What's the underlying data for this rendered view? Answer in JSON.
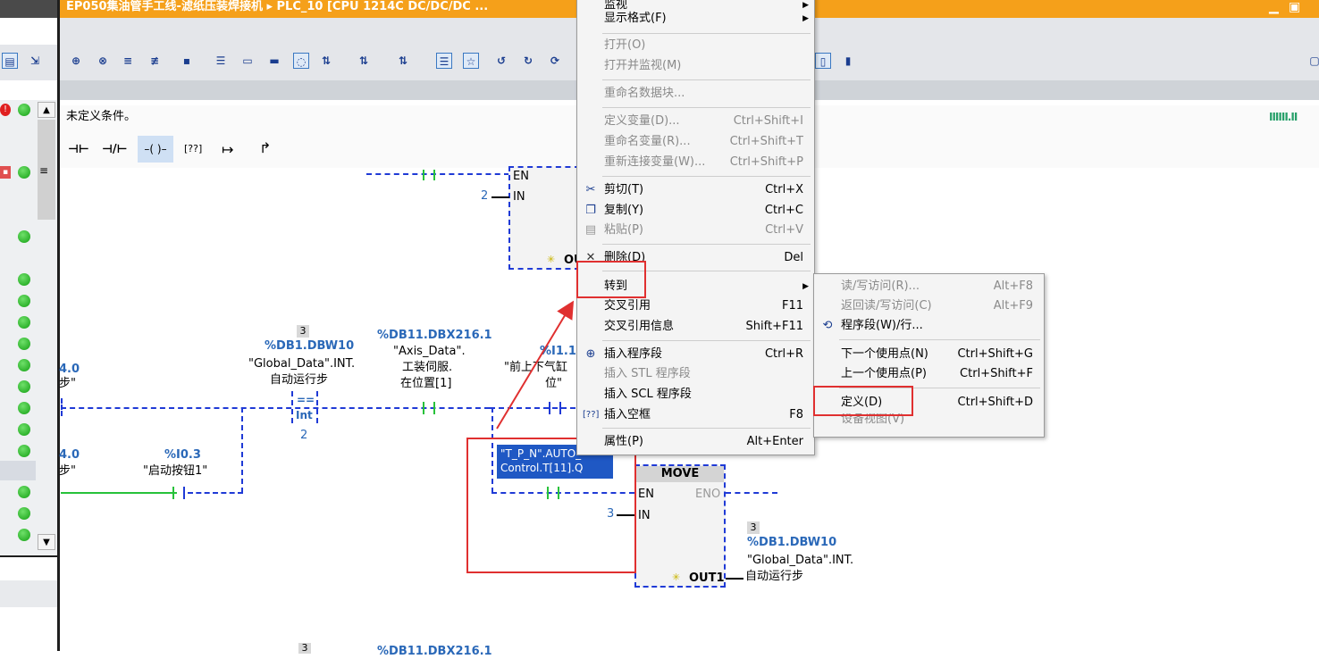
{
  "window": {
    "title": "EP050集油管手工线-滤纸压装焊接机 ▸ PLC_10 [CPU 1214C DC/DC/DC ..."
  },
  "editor": {
    "condition_text": "未定义条件。",
    "ladder_tools": [
      "⊣⊢",
      "⊣/⊢",
      "–( )–",
      "[??]",
      "↦",
      "↱"
    ]
  },
  "network": {
    "in_const_top": "2",
    "block_labels": {
      "en": "EN",
      "in": "IN",
      "out": "OUT1",
      "eno": "ENO"
    },
    "rung1_left_addr": "4.0",
    "rung1_left_tag": "步\"",
    "cmp_const": "3",
    "cmp_addr": "%DB1.DBW10",
    "cmp_tag1": "\"Global_Data\".INT.",
    "cmp_tag2": "自动运行步",
    "cmp_op1": "==",
    "cmp_op2": "Int",
    "cmp_below": "2",
    "axis_addr": "%DB11.DBX216.1",
    "axis_tag1": "\"Axis_Data\".",
    "axis_tag2": "工装伺服.",
    "axis_tag3": "在位置[1]",
    "cyl_addr": "%I1.1",
    "cyl_tag1": "\"前上下气缸",
    "cyl_tag2": "位\"",
    "rung2_left_addr": "4.0",
    "rung2_left_tag": "步\"",
    "start_addr": "%I0.3",
    "start_tag": "\"启动按钮1\"",
    "tpn_line1": "\"T_P_N\".AUTO_",
    "tpn_line2": "Control.T[11].Q",
    "move_title": "MOVE",
    "move_in": "3",
    "move_out_const": "3",
    "move_out_addr": "%DB1.DBW10",
    "move_out_tag1": "\"Global_Data\".INT.",
    "move_out_tag2": "自动运行步",
    "bottom_const": "3",
    "bottom_addr": "%DB11.DBX216.1"
  },
  "context_menu": {
    "items": [
      {
        "label": "监视",
        "shortcut": "",
        "disabled": false,
        "submenu": true
      },
      {
        "label": "显示格式(F)",
        "shortcut": "",
        "disabled": false,
        "submenu": true
      },
      {
        "label": "打开(O)",
        "shortcut": "",
        "disabled": true
      },
      {
        "label": "打开并监视(M)",
        "shortcut": "",
        "disabled": true
      },
      {
        "label": "重命名数据块...",
        "shortcut": "",
        "disabled": true
      },
      {
        "label": "定义变量(D)...",
        "shortcut": "Ctrl+Shift+I",
        "disabled": true
      },
      {
        "label": "重命名变量(R)...",
        "shortcut": "Ctrl+Shift+T",
        "disabled": true
      },
      {
        "label": "重新连接变量(W)...",
        "shortcut": "Ctrl+Shift+P",
        "disabled": true
      },
      {
        "label": "剪切(T)",
        "shortcut": "Ctrl+X",
        "disabled": false,
        "icon": "scissors-icon"
      },
      {
        "label": "复制(Y)",
        "shortcut": "Ctrl+C",
        "disabled": false,
        "icon": "copy-icon"
      },
      {
        "label": "粘贴(P)",
        "shortcut": "Ctrl+V",
        "disabled": true,
        "icon": "paste-icon"
      },
      {
        "label": "删除(D)",
        "shortcut": "Del",
        "disabled": false,
        "icon": "delete-icon"
      },
      {
        "label": "转到",
        "shortcut": "",
        "disabled": false,
        "submenu": true
      },
      {
        "label": "交叉引用",
        "shortcut": "F11",
        "disabled": false
      },
      {
        "label": "交叉引用信息",
        "shortcut": "Shift+F11",
        "disabled": false
      },
      {
        "label": "插入程序段",
        "shortcut": "Ctrl+R",
        "disabled": false,
        "icon": "insert-network-icon"
      },
      {
        "label": "插入 STL 程序段",
        "shortcut": "",
        "disabled": true
      },
      {
        "label": "插入 SCL 程序段",
        "shortcut": "",
        "disabled": false
      },
      {
        "label": "插入空框",
        "shortcut": "F8",
        "disabled": false,
        "icon": "empty-box-icon"
      },
      {
        "label": "属性(P)",
        "shortcut": "Alt+Enter",
        "disabled": false
      }
    ]
  },
  "submenu": {
    "items": [
      {
        "label": "读/写访问(R)...",
        "shortcut": "Alt+F8",
        "disabled": true
      },
      {
        "label": "返回读/写访问(C)",
        "shortcut": "Alt+F9",
        "disabled": true
      },
      {
        "label": "程序段(W)/行...",
        "shortcut": "",
        "disabled": false,
        "icon": "goto-network-icon"
      },
      {
        "label": "下一个使用点(N)",
        "shortcut": "Ctrl+Shift+G",
        "disabled": false
      },
      {
        "label": "上一个使用点(P)",
        "shortcut": "Ctrl+Shift+F",
        "disabled": false
      },
      {
        "label": "定义(D)",
        "shortcut": "Ctrl+Shift+D",
        "disabled": false
      },
      {
        "label": "设备视图(V)",
        "shortcut": "",
        "disabled": true
      }
    ]
  },
  "colors": {
    "titlebar": "#f5a01a",
    "annotation_red": "#e03030",
    "wire_blue": "#1f3ad6",
    "wire_green": "#27c23a"
  }
}
